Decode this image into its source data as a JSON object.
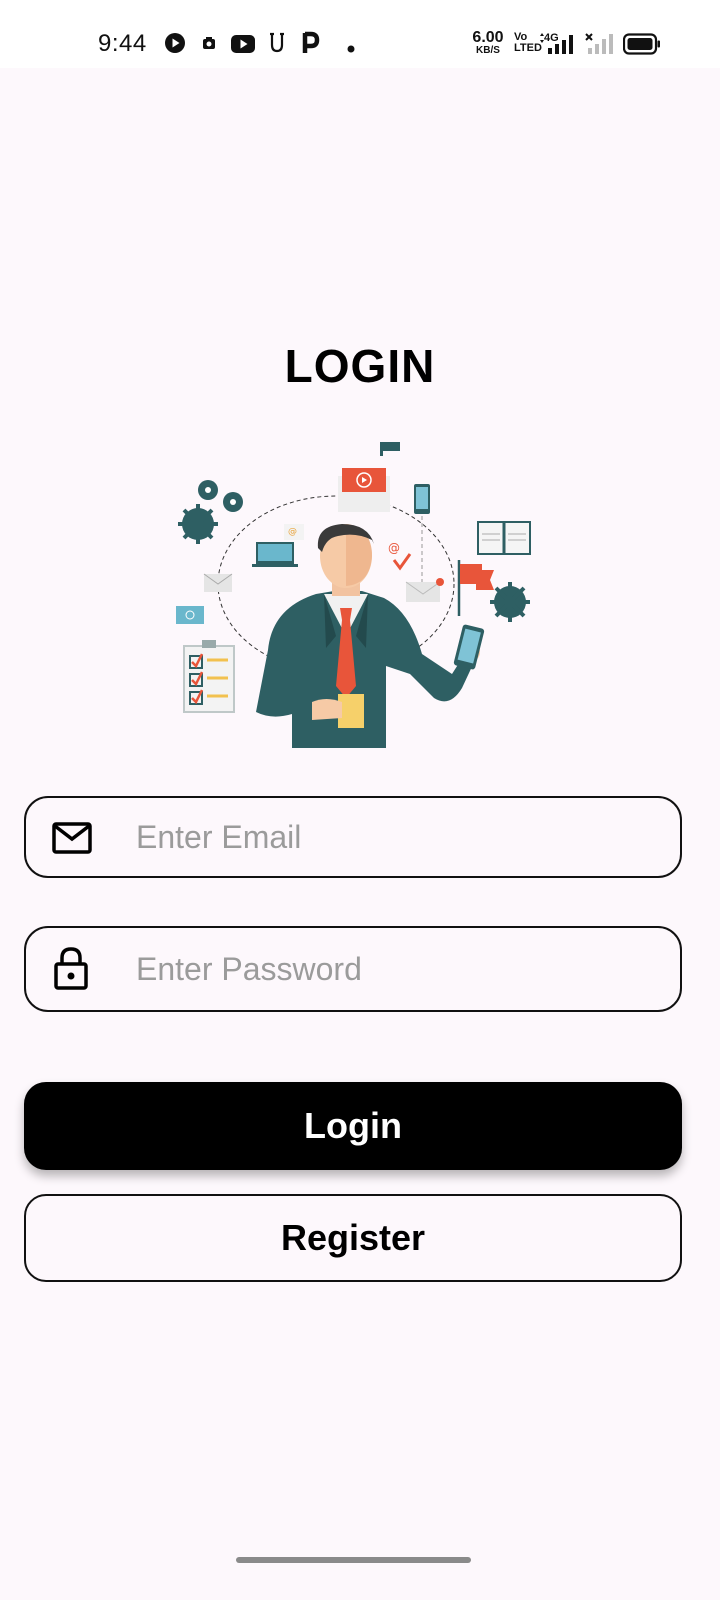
{
  "status_bar": {
    "time": "9:44",
    "net_speed_value": "6.00",
    "net_speed_unit": "KB/S",
    "volte_line1": "Vo",
    "volte_line2": "LTED",
    "network": "4G",
    "icons": [
      "play-circle-icon",
      "camera-icon",
      "youtube-icon",
      "u-app-icon",
      "p-app-icon",
      "dot-icon",
      "signal-icon",
      "no-signal-icon",
      "battery-icon"
    ]
  },
  "login": {
    "title": "LOGIN",
    "illustration": "businessman-multitasking-illustration",
    "email_placeholder": "Enter Email",
    "email_value": "",
    "password_placeholder": "Enter Password",
    "password_value": "",
    "login_button": "Login",
    "register_button": "Register"
  },
  "colors": {
    "background": "#fdf8fc",
    "primary_button": "#000000",
    "primary_button_text": "#ffffff",
    "border": "#111111",
    "placeholder": "#9b9b9b",
    "illustration_teal": "#2e5f63",
    "illustration_orange": "#e8553a"
  }
}
